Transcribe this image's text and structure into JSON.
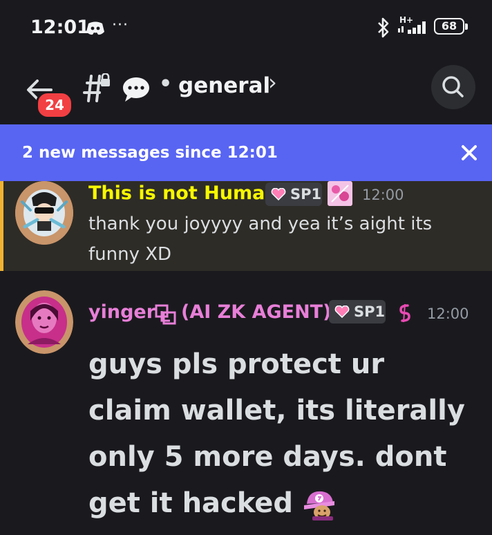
{
  "status_bar": {
    "time": "12:01",
    "dots": "···",
    "network": "H+",
    "battery": "68"
  },
  "header": {
    "badge_count": "24",
    "channel": "general",
    "channel_prefix": "•",
    "chevron": "›"
  },
  "banner": {
    "text": "2 new messages since 12:01"
  },
  "messages": [
    {
      "username": "This is not Human",
      "username_color": "#f7f700",
      "role": "SP1",
      "time": "12:00",
      "lines": [
        "thank you joyyyy and yea it’s aight its",
        "funny XD"
      ]
    },
    {
      "username": "yinger",
      "username_suffix": "(AI ZK AGENT)",
      "username_color": "#e87fd8",
      "role": "SP1",
      "time": "12:00",
      "text": "guys pls protect ur claim wallet, its literally only 5 more days. dont get it hacked"
    }
  ],
  "icons": {
    "back": "arrow-left-icon",
    "channel": "hash-lock-icon",
    "thread": "speech-bubble-icon",
    "search": "search-icon",
    "close": "close-icon",
    "bluetooth": "bluetooth-icon",
    "discord": "discord-icon"
  },
  "colors": {
    "accent": "#5865f2",
    "badge": "#f23f43",
    "highlight_bar": "#f0b232"
  }
}
